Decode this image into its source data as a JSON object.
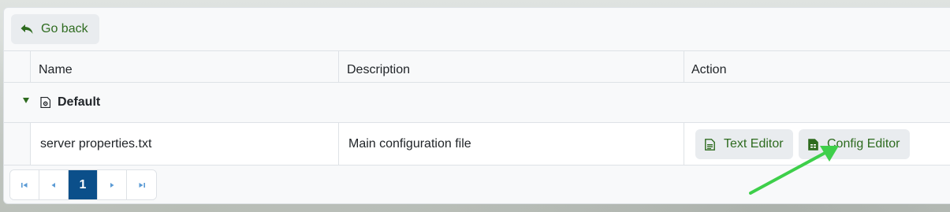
{
  "toolbar": {
    "back_label": "Go back"
  },
  "table": {
    "headers": {
      "name": "Name",
      "description": "Description",
      "action": "Action"
    },
    "group": {
      "label": "Default"
    },
    "rows": [
      {
        "name": "server properties.txt",
        "description": "Main configuration file",
        "actions": {
          "text_editor": "Text Editor",
          "config_editor": "Config Editor"
        }
      }
    ]
  },
  "pagination": {
    "current_page": "1"
  },
  "colors": {
    "accent_green": "#2e6b1f",
    "active_page": "#0b4f8a",
    "annotation_arrow": "#3ecf4a"
  }
}
